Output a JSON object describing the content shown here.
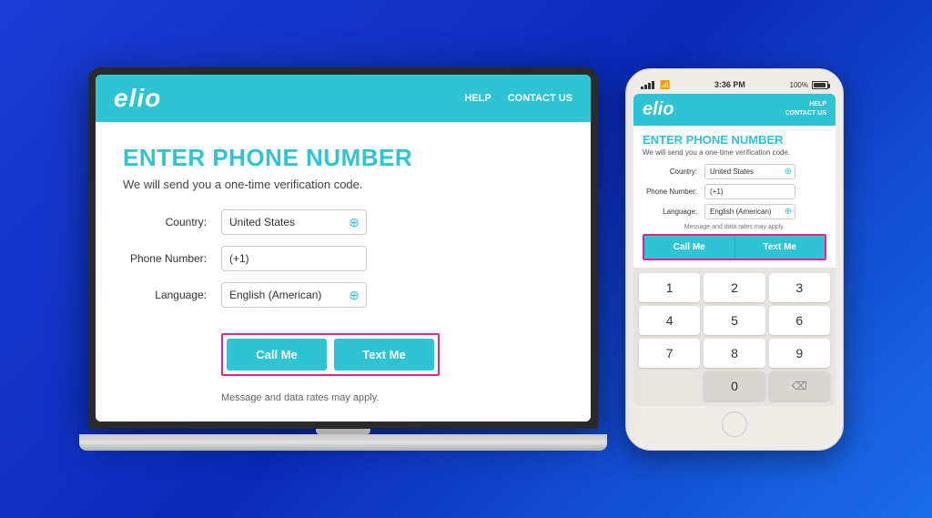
{
  "background": "#1a3ed4",
  "laptop": {
    "nav": {
      "logo": "elio",
      "links": [
        "HELP",
        "CONTACT US"
      ]
    },
    "page": {
      "title": "ENTER PHONE NUMBER",
      "subtitle": "We will send you a one-time verification code.",
      "form": {
        "country_label": "Country:",
        "country_value": "United States",
        "phone_label": "Phone Number:",
        "phone_value": "(+1)",
        "language_label": "Language:",
        "language_value": "English (American)"
      },
      "buttons": {
        "call": "Call Me",
        "text": "Text Me"
      },
      "disclaimer": "Message and data rates may apply."
    }
  },
  "phone": {
    "status": {
      "time": "3:36 PM",
      "battery": "100%"
    },
    "nav": {
      "logo": "elio",
      "links": [
        "HELP",
        "CONTACT US"
      ]
    },
    "page": {
      "title": "ENTER PHONE NUMBER",
      "subtitle": "We will send you a one-time verification code.",
      "form": {
        "country_label": "Country:",
        "country_value": "United States",
        "phone_label": "Phone Number:",
        "phone_value": "(+1)",
        "language_label": "Language:",
        "language_value": "English (American)"
      },
      "buttons": {
        "call": "Call Me",
        "text": "Text Me"
      },
      "disclaimer": "Message and data rates may apply."
    },
    "keypad": {
      "keys": [
        "1",
        "2",
        "3",
        "4",
        "5",
        "6",
        "7",
        "8",
        "9",
        "0",
        "⌫"
      ]
    }
  }
}
